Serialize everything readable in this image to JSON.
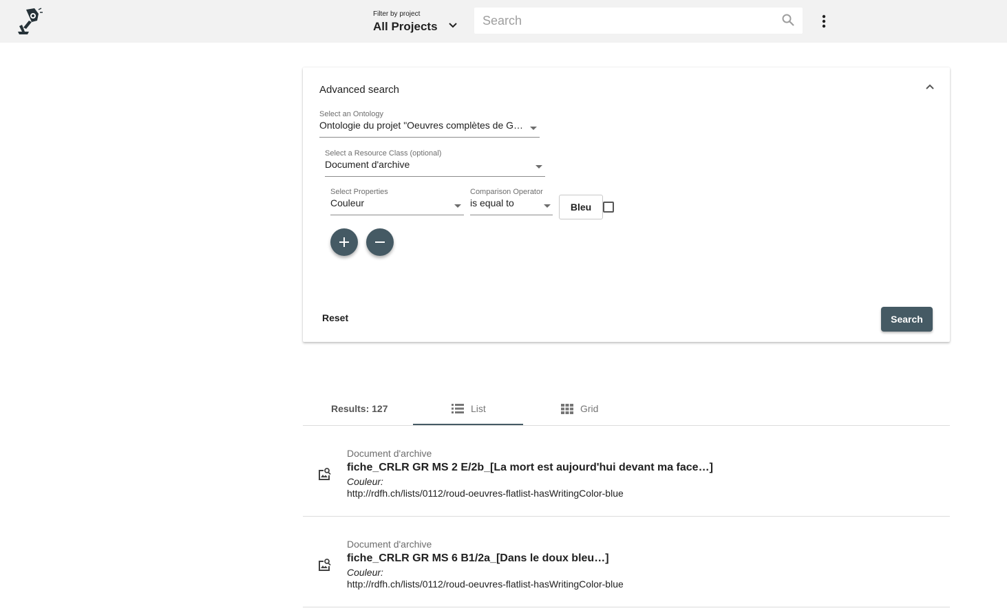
{
  "header": {
    "filter_label": "Filter by project",
    "filter_value": "All Projects",
    "search_placeholder": "Search"
  },
  "advanced_search": {
    "title": "Advanced search",
    "ontology": {
      "label": "Select an Ontology",
      "value": "Ontologie du projet \"Oeuvres complètes de Gus…"
    },
    "resource_class": {
      "label": "Select a Resource Class (optional)",
      "value": "Document d'archive"
    },
    "property": {
      "label": "Select Properties",
      "value": "Couleur"
    },
    "operator": {
      "label": "Comparison Operator",
      "value": "is equal to"
    },
    "value": "Bleu",
    "reset_label": "Reset",
    "search_label": "Search"
  },
  "results": {
    "tabs": {
      "count": "Results: 127",
      "list": "List",
      "grid": "Grid"
    },
    "items": [
      {
        "type": "Document d'archive",
        "title": "fiche_CRLR GR MS 2 E/2b_[La mort est aujourd'hui devant ma face…]",
        "property": "Couleur:",
        "value": "http://rdfh.ch/lists/0112/roud-oeuvres-flatlist-hasWritingColor-blue"
      },
      {
        "type": "Document d'archive",
        "title": "fiche_CRLR GR MS 6 B1/2a_[Dans le doux bleu…]",
        "property": "Couleur:",
        "value": "http://rdfh.ch/lists/0112/roud-oeuvres-flatlist-hasWritingColor-blue"
      }
    ]
  },
  "colors": {
    "primary": "#455a64",
    "topbar": "#f2f2f2"
  }
}
